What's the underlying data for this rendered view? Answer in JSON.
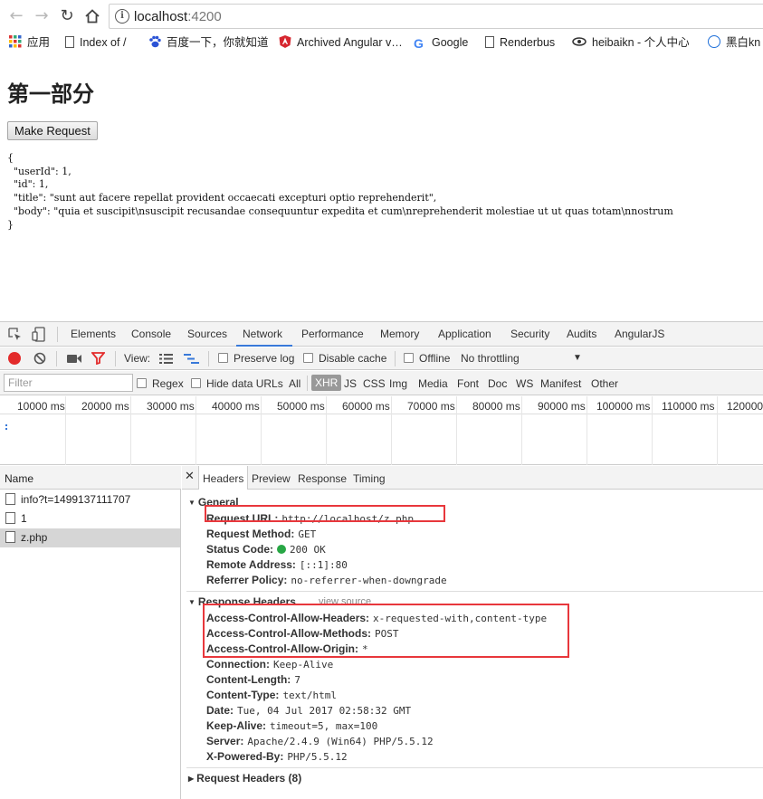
{
  "browser": {
    "url_host": "localhost",
    "url_port": ":4200",
    "bookmarks": [
      "应用",
      "Index of /",
      "百度一下，你就知道",
      "Archived Angular v…",
      "Google",
      "Renderbus",
      "heibaikn - 个人中心",
      "黑白kn"
    ]
  },
  "page": {
    "heading": "第一部分",
    "button_label": "Make Request",
    "response_json": "{\n  \"userId\": 1,\n  \"id\": 1,\n  \"title\": \"sunt aut facere repellat provident occaecati excepturi optio reprehenderit\",\n  \"body\": \"quia et suscipit\\nsuscipit recusandae consequuntur expedita et cum\\nreprehenderit molestiae ut ut quas totam\\nnostrum\n}"
  },
  "devtools": {
    "tabs": [
      "Elements",
      "Console",
      "Sources",
      "Network",
      "Performance",
      "Memory",
      "Application",
      "Security",
      "Audits",
      "AngularJS"
    ],
    "active_tab": "Network",
    "toolbar": {
      "view_label": "View:",
      "preserve_log": "Preserve log",
      "disable_cache": "Disable cache",
      "offline": "Offline",
      "throttling": "No throttling"
    },
    "filter": {
      "placeholder": "Filter",
      "regex": "Regex",
      "hide_data_urls": "Hide data URLs",
      "types": [
        "All",
        "XHR",
        "JS",
        "CSS",
        "Img",
        "Media",
        "Font",
        "Doc",
        "WS",
        "Manifest",
        "Other"
      ],
      "selected_type": "XHR"
    },
    "timeline_ticks": [
      "10000 ms",
      "20000 ms",
      "30000 ms",
      "40000 ms",
      "50000 ms",
      "60000 ms",
      "70000 ms",
      "80000 ms",
      "90000 ms",
      "100000 ms",
      "110000 ms",
      "120000"
    ],
    "name_header": "Name",
    "requests": [
      "info?t=1499137111707",
      "1",
      "z.php"
    ],
    "selected_request": "z.php",
    "detail_tabs": [
      "Headers",
      "Preview",
      "Response",
      "Timing"
    ],
    "general": {
      "title": "General",
      "rows": [
        {
          "k": "Request URL:",
          "v": "http://localhost/z.php"
        },
        {
          "k": "Request Method:",
          "v": "GET"
        },
        {
          "k": "Status Code:",
          "v": "200 OK"
        },
        {
          "k": "Remote Address:",
          "v": "[::1]:80"
        },
        {
          "k": "Referrer Policy:",
          "v": "no-referrer-when-downgrade"
        }
      ]
    },
    "response_headers": {
      "title": "Response Headers",
      "view_source": "view source",
      "rows": [
        {
          "k": "Access-Control-Allow-Headers:",
          "v": "x-requested-with,content-type"
        },
        {
          "k": "Access-Control-Allow-Methods:",
          "v": "POST"
        },
        {
          "k": "Access-Control-Allow-Origin:",
          "v": "*"
        },
        {
          "k": "Connection:",
          "v": "Keep-Alive"
        },
        {
          "k": "Content-Length:",
          "v": "7"
        },
        {
          "k": "Content-Type:",
          "v": "text/html"
        },
        {
          "k": "Date:",
          "v": "Tue, 04 Jul 2017 02:58:32 GMT"
        },
        {
          "k": "Keep-Alive:",
          "v": "timeout=5, max=100"
        },
        {
          "k": "Server:",
          "v": "Apache/2.4.9 (Win64) PHP/5.5.12"
        },
        {
          "k": "X-Powered-By:",
          "v": "PHP/5.5.12"
        }
      ]
    },
    "request_headers": {
      "title": "Request Headers (8)"
    },
    "colors": {
      "highlight_box": "#e8373c",
      "record": "#e32b2b",
      "status_ok": "#28a745",
      "tab_accent": "#3879d9"
    }
  }
}
